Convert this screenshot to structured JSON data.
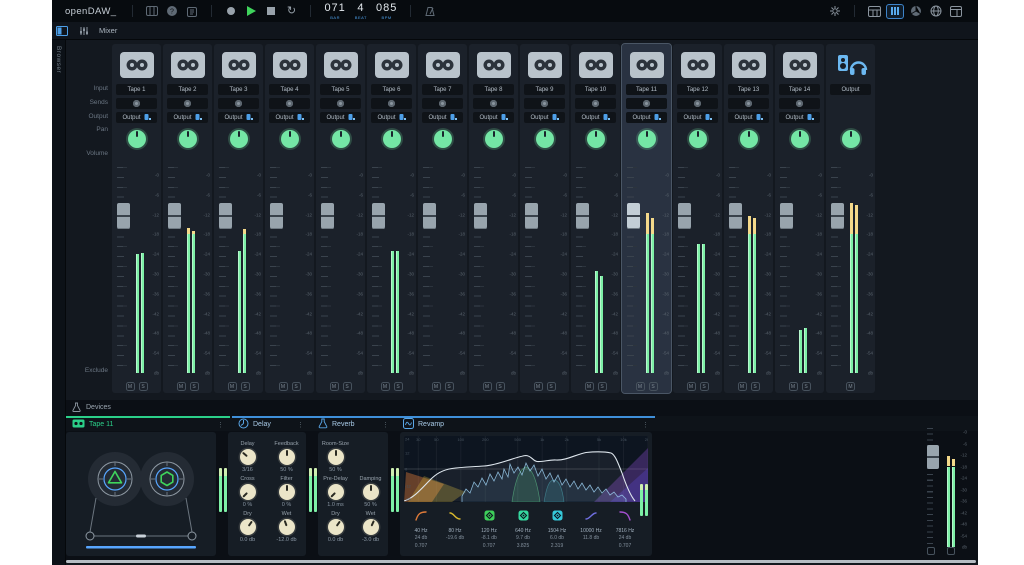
{
  "app": {
    "title": "openDAW_"
  },
  "topbar": {
    "time": {
      "bar": "071",
      "bar_label": "BAR",
      "beat": "4",
      "beat_label": "BEAT",
      "bpm": "085",
      "bpm_label": "BPM"
    }
  },
  "panel": {
    "mixer_tab": "Mixer",
    "browser_label": "Browser"
  },
  "colors": {
    "accent_blue": "#4d9fe8",
    "green": "#74e6a5",
    "meter_green": "#7df0a6",
    "meter_yellow": "#f4d98a",
    "tab_green": "#2bd089",
    "knob_cream": "#ebe5c8"
  },
  "mixer": {
    "row_labels": {
      "input": "Input",
      "sends": "Sends",
      "output": "Output",
      "pan": "Pan",
      "volume": "Volume",
      "exclude": "Exclude"
    },
    "db_scale": [
      "-0",
      "-6",
      "-12",
      "-18",
      "-24",
      "-30",
      "-36",
      "-42",
      "-48",
      "-54",
      "db"
    ],
    "mute_label": "M",
    "solo_label": "S",
    "output_label": "Output",
    "fader_db": -12.5,
    "channels": [
      {
        "name": "Tape 1",
        "meter": [
          -24,
          -23.5
        ]
      },
      {
        "name": "Tape 2",
        "meter": [
          -16,
          -17
        ]
      },
      {
        "name": "Tape 3",
        "meter": [
          -23,
          -16.5
        ]
      },
      {
        "name": "Tape 4",
        "meter": [
          null,
          null
        ]
      },
      {
        "name": "Tape 5",
        "meter": [
          null,
          null
        ]
      },
      {
        "name": "Tape 6",
        "meter": [
          -23,
          -23
        ]
      },
      {
        "name": "Tape 7",
        "meter": [
          null,
          null
        ]
      },
      {
        "name": "Tape 8",
        "meter": [
          null,
          null
        ]
      },
      {
        "name": "Tape 9",
        "meter": [
          null,
          null
        ]
      },
      {
        "name": "Tape 10",
        "meter": [
          -29,
          -30.5
        ]
      },
      {
        "name": "Tape 11",
        "meter": [
          -11.5,
          -13
        ],
        "selected": true
      },
      {
        "name": "Tape 12",
        "meter": [
          -21,
          -21
        ]
      },
      {
        "name": "Tape 13",
        "meter": [
          -12.5,
          -13
        ]
      },
      {
        "name": "Tape 14",
        "meter": [
          -47,
          -46.5
        ]
      },
      {
        "name": "Output",
        "meter": [
          -8.5,
          -9
        ],
        "master": true
      }
    ]
  },
  "devices": {
    "header": "Devices",
    "chain": [
      {
        "name": "Tape 11",
        "color": "green",
        "icon": "tape"
      },
      {
        "name": "Delay",
        "color": "blue",
        "icon": "delay"
      },
      {
        "name": "Reverb",
        "color": "blue",
        "icon": "reverb"
      },
      {
        "name": "Revamp",
        "color": "blue",
        "icon": "revamp"
      }
    ],
    "delay": {
      "rows": [
        [
          {
            "label": "Delay",
            "value": "3/16",
            "angle": -50
          },
          {
            "label": "Feedback",
            "value": "50 %",
            "angle": 0
          }
        ],
        [
          {
            "label": "Cross",
            "value": "0 %",
            "angle": -135
          },
          {
            "label": "Filter",
            "value": "0 %",
            "angle": 0
          }
        ],
        [
          {
            "label": "Dry",
            "value": "0.0 db",
            "angle": 35
          },
          {
            "label": "Wet",
            "value": "-12.0 db",
            "angle": -20
          }
        ]
      ]
    },
    "reverb": {
      "rows": [
        [
          {
            "label": "Room-Size",
            "value": "50 %",
            "angle": 0
          }
        ],
        [
          {
            "label": "Pre-Delay",
            "value": "1.0 ms",
            "angle": -135
          },
          {
            "label": "Damping",
            "value": "50 %",
            "angle": 0
          }
        ],
        [
          {
            "label": "Dry",
            "value": "0.0 db",
            "angle": 35
          },
          {
            "label": "Wet",
            "value": "-3.0 db",
            "angle": 25
          }
        ]
      ]
    },
    "revamp": {
      "freq_axis": [
        {
          "label": "30",
          "hz": 30
        },
        {
          "label": "50",
          "hz": 50
        },
        {
          "label": "100",
          "hz": 100
        },
        {
          "label": "200",
          "hz": 200
        },
        {
          "label": "500",
          "hz": 500
        },
        {
          "label": "1k",
          "hz": 1000
        },
        {
          "label": "2k",
          "hz": 2000
        },
        {
          "label": "5k",
          "hz": 5000
        },
        {
          "label": "10k",
          "hz": 10000
        },
        {
          "label": "20k",
          "hz": 20000
        }
      ],
      "db_axis": [
        "24",
        "12",
        "0",
        "-12",
        "-24"
      ],
      "bands": [
        {
          "type": "highpass",
          "color": "#e07b39",
          "freq": "40 Hz",
          "gain": "24 db",
          "q": "0.707"
        },
        {
          "type": "lowshelf",
          "color": "#d8b82e",
          "freq": "80 Hz",
          "gain": "-19.6 db",
          "q": ""
        },
        {
          "type": "bell",
          "color": "#3ecf5a",
          "freq": "120 Hz",
          "gain": "-8.1 db",
          "q": "0.707"
        },
        {
          "type": "bell",
          "color": "#35d9a0",
          "freq": "640 Hz",
          "gain": "9.7 db",
          "q": "3.825"
        },
        {
          "type": "bell",
          "color": "#35c8d9",
          "freq": "1504 Hz",
          "gain": "6.0 db",
          "q": "2.319"
        },
        {
          "type": "highshelf",
          "color": "#6f6fe0",
          "freq": "10000 Hz",
          "gain": "11.8 db",
          "q": ""
        },
        {
          "type": "lowpass",
          "color": "#a44fd0",
          "freq": "7816 Hz",
          "gain": "24 db",
          "q": "0.707"
        }
      ]
    },
    "master": {
      "db_scale": [
        "-0",
        "-6",
        "-12",
        "-18",
        "-24",
        "-30",
        "-36",
        "-42",
        "-48",
        "-54",
        "db"
      ],
      "meter": [
        -12.5,
        -14
      ],
      "fader_db": -13
    }
  }
}
